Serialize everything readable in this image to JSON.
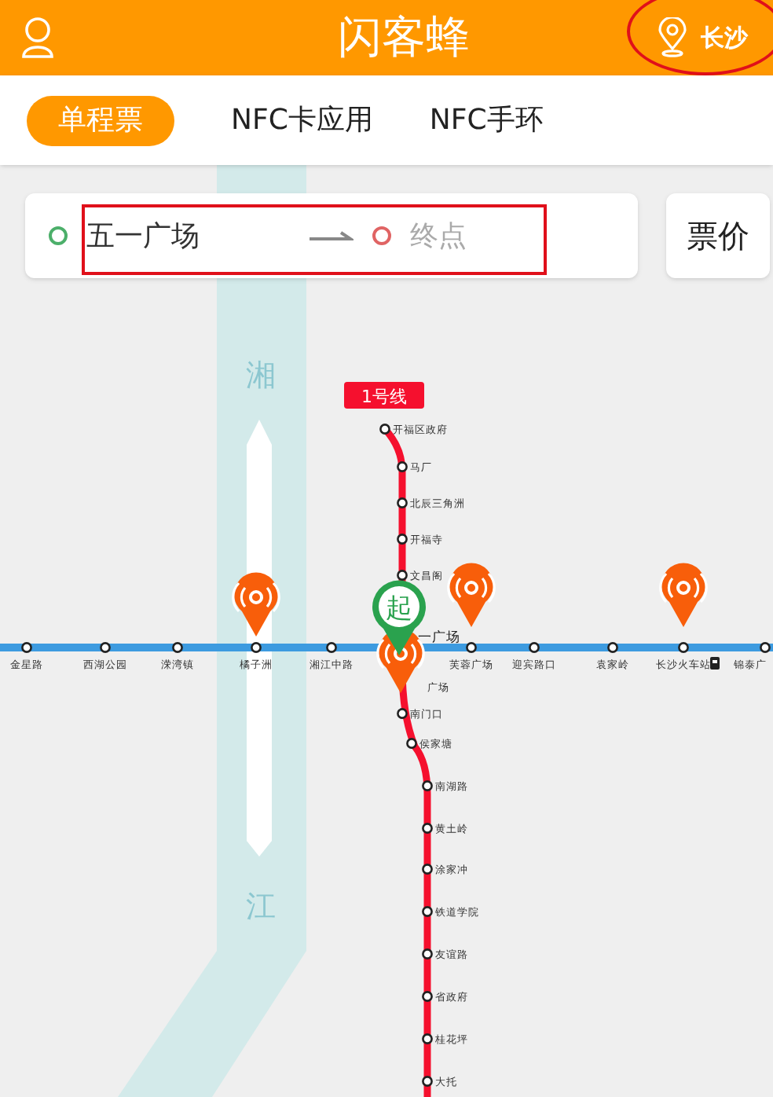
{
  "header": {
    "title": "闪客蜂",
    "city": "长沙"
  },
  "tabs": [
    {
      "label": "单程票",
      "selected": true
    },
    {
      "label": "NFC卡应用",
      "selected": false
    },
    {
      "label": "NFC手环",
      "selected": false
    }
  ],
  "route": {
    "origin": "五一广场",
    "destination_placeholder": "终点"
  },
  "fare_button": "票价",
  "map": {
    "river_labels": [
      "湘",
      "江"
    ],
    "line_badge": "1号线",
    "start_marker": "起",
    "lines": [
      {
        "color": "#f5102e",
        "stations": [
          {
            "name": "开福区政府"
          },
          {
            "name": "马厂"
          },
          {
            "name": "北辰三角洲"
          },
          {
            "name": "开福寺"
          },
          {
            "name": "文昌阁"
          },
          {
            "name": "广场"
          },
          {
            "name": "南门口"
          },
          {
            "name": "侯家塘"
          },
          {
            "name": "南湖路"
          },
          {
            "name": "黄土岭"
          },
          {
            "name": "涂家冲"
          },
          {
            "name": "铁道学院"
          },
          {
            "name": "友谊路"
          },
          {
            "name": "省政府"
          },
          {
            "name": "桂花坪"
          },
          {
            "name": "大托"
          }
        ]
      },
      {
        "color": "#3d9be0",
        "stations": [
          {
            "name": "金星路"
          },
          {
            "name": "西湖公园"
          },
          {
            "name": "溁湾镇"
          },
          {
            "name": "橘子洲"
          },
          {
            "name": "湘江中路"
          },
          {
            "name": "一广场"
          },
          {
            "name": "芙蓉广场"
          },
          {
            "name": "迎宾路口"
          },
          {
            "name": "袁家岭"
          },
          {
            "name": "长沙火车站"
          },
          {
            "name": "锦泰广"
          }
        ]
      }
    ]
  }
}
